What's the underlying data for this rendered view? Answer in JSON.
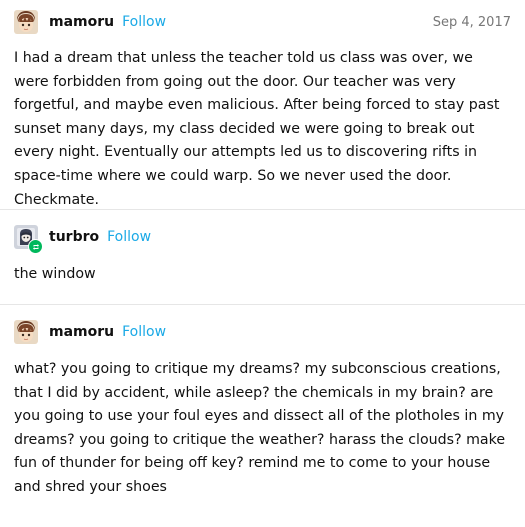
{
  "posts": [
    {
      "username": "mamoru",
      "follow_label": "Follow",
      "date": "Sep 4, 2017",
      "avatar_icon": "mamoru-avatar-icon",
      "text": "I had a dream that unless the teacher told us class was over, we were forbidden from going out the door. Our teacher was very forgetful, and maybe even malicious. After being forced to stay past sunset many days, my class decided we were going to break out every night. Eventually our attempts led us to discovering rifts in space-time where we could warp. So we never used the door. Checkmate."
    },
    {
      "username": "turbro",
      "follow_label": "Follow",
      "avatar_icon": "turbro-avatar-icon",
      "badge_icon": "reblog-icon",
      "text": "the window"
    },
    {
      "username": "mamoru",
      "follow_label": "Follow",
      "avatar_icon": "mamoru-avatar-icon",
      "text": "what? you going to critique my dreams? my subconscious creations, that I did by accident, while asleep? the chemicals in my brain? are you going to use your foul eyes and dissect all of the plotholes in my dreams? you going to critique the weather? harass the clouds? make fun of thunder for being off key? remind me to come to your house and shred your shoes"
    }
  ],
  "colors": {
    "follow": "#1aa9e6",
    "divider": "#e6e6e6",
    "reblog_badge": "#00b85c",
    "date": "#777777"
  }
}
